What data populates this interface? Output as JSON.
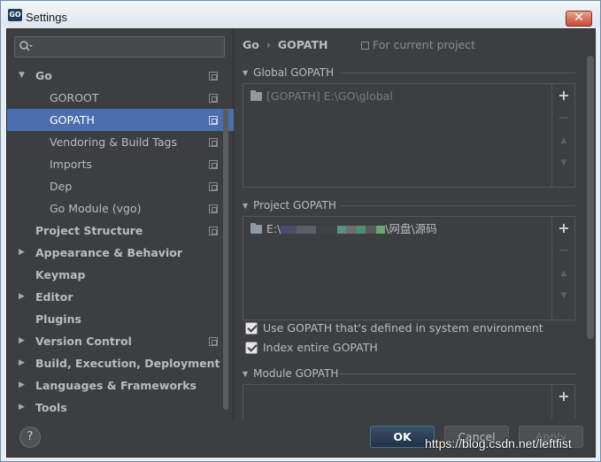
{
  "window": {
    "title": "Settings",
    "logo_text": "GO",
    "close_glyph": "✕"
  },
  "search": {
    "value": "",
    "placeholder": "",
    "icon": "search-icon"
  },
  "tree": [
    {
      "label": "Go",
      "level": 0,
      "expanded": true,
      "bold": true,
      "project_icon": true
    },
    {
      "label": "GOROOT",
      "level": 1,
      "project_icon": true
    },
    {
      "label": "GOPATH",
      "level": 1,
      "selected": true,
      "project_icon": true
    },
    {
      "label": "Vendoring & Build Tags",
      "level": 1,
      "project_icon": true
    },
    {
      "label": "Imports",
      "level": 1,
      "project_icon": true
    },
    {
      "label": "Dep",
      "level": 1,
      "project_icon": true
    },
    {
      "label": "Go Module (vgo)",
      "level": 1,
      "project_icon": true
    },
    {
      "label": "Project Structure",
      "level": 0,
      "bold": true,
      "project_icon": true
    },
    {
      "label": "Appearance & Behavior",
      "level": 0,
      "bold": true,
      "collapsed": true
    },
    {
      "label": "Keymap",
      "level": 0,
      "bold": true
    },
    {
      "label": "Editor",
      "level": 0,
      "bold": true,
      "collapsed": true
    },
    {
      "label": "Plugins",
      "level": 0,
      "bold": true
    },
    {
      "label": "Version Control",
      "level": 0,
      "bold": true,
      "collapsed": true,
      "project_icon": true
    },
    {
      "label": "Build, Execution, Deployment",
      "level": 0,
      "bold": true,
      "collapsed": true
    },
    {
      "label": "Languages & Frameworks",
      "level": 0,
      "bold": true,
      "collapsed": true
    },
    {
      "label": "Tools",
      "level": 0,
      "bold": true,
      "collapsed": true
    }
  ],
  "breadcrumb": {
    "parent": "Go",
    "separator": "›",
    "current": "GOPATH",
    "scope": "For current project"
  },
  "global_gopath": {
    "title": "Global GOPATH",
    "items": [
      "[GOPATH] E:\\GO\\global"
    ]
  },
  "project_gopath": {
    "title": "Project GOPATH",
    "item_prefix": "E:\\",
    "item_suffix": "\\网盘\\源码"
  },
  "checkboxes": {
    "use_system": "Use GOPATH that's defined in system environment",
    "index_entire": "Index entire GOPATH"
  },
  "module_gopath": {
    "title": "Module GOPATH"
  },
  "tools": {
    "add": "+",
    "remove": "−",
    "up": "▲",
    "down": "▼"
  },
  "footer": {
    "help": "?",
    "ok": "OK",
    "cancel": "Cancel",
    "apply": "Apply"
  },
  "watermark": "https://blog.csdn.net/leftfist"
}
